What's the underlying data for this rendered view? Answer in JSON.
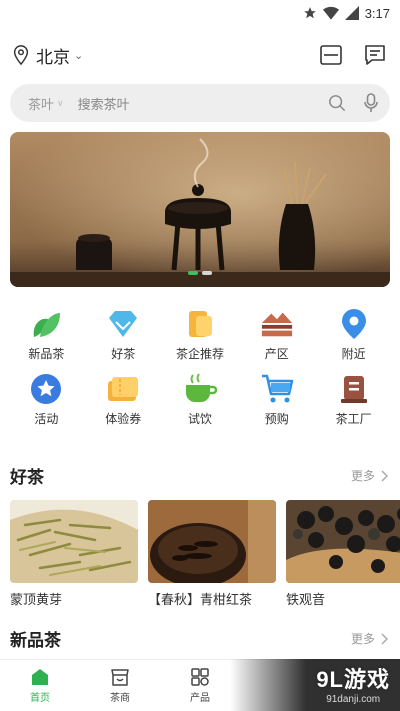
{
  "status_bar": {
    "time": "3:17"
  },
  "location": {
    "city": "北京"
  },
  "search": {
    "category": "茶叶",
    "placeholder": "搜索茶叶"
  },
  "banner": {
    "slides": 2,
    "active_index": 0
  },
  "categories": [
    {
      "label": "新品茶",
      "icon": "leaf-icon"
    },
    {
      "label": "好茶",
      "icon": "diamond-icon"
    },
    {
      "label": "茶企推荐",
      "icon": "document-icon"
    },
    {
      "label": "产区",
      "icon": "mountain-icon"
    },
    {
      "label": "附近",
      "icon": "location-pin-icon"
    },
    {
      "label": "活动",
      "icon": "star-icon"
    },
    {
      "label": "体验券",
      "icon": "coupon-icon"
    },
    {
      "label": "试饮",
      "icon": "tea-cup-icon"
    },
    {
      "label": "预购",
      "icon": "cart-icon"
    },
    {
      "label": "茶工厂",
      "icon": "factory-icon"
    }
  ],
  "good_tea": {
    "title": "好茶",
    "more": "更多",
    "items": [
      {
        "name": "蒙顶黄芽"
      },
      {
        "name": "【春秋】青柑红茶"
      },
      {
        "name": "铁观音"
      }
    ]
  },
  "new_tea": {
    "title": "新品茶",
    "more": "更多"
  },
  "tabbar": [
    {
      "label": "首页",
      "active": true
    },
    {
      "label": "茶商",
      "active": false
    },
    {
      "label": "产品",
      "active": false
    }
  ],
  "watermark": {
    "brand": "9L游戏",
    "domain": "91danji.com"
  },
  "colors": {
    "accent": "#2cb050",
    "search_bg": "#eeeeee"
  }
}
